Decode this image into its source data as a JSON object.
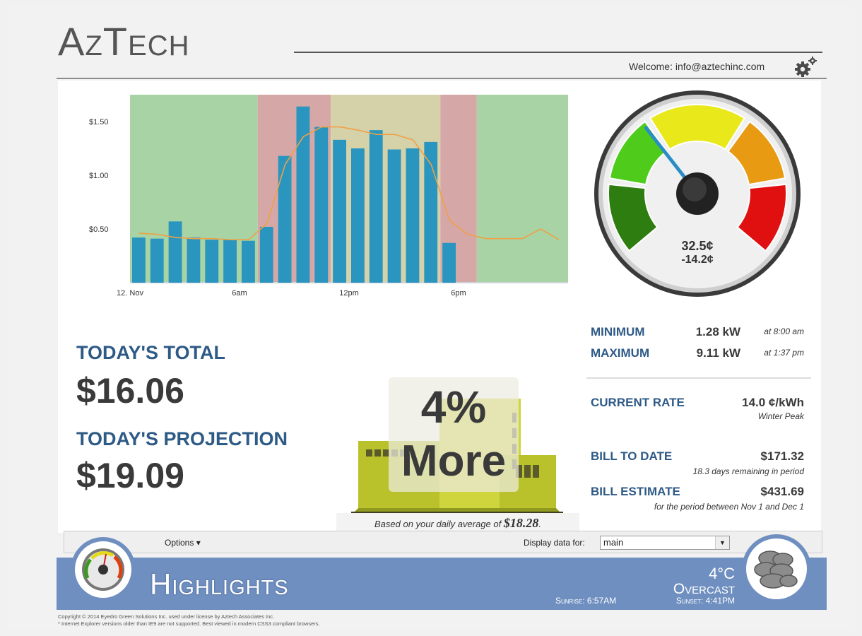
{
  "header": {
    "logo_first": "A",
    "logo_second": "Z",
    "logo_third": "T",
    "logo_rest": "ECH",
    "welcome": "Welcome: info@aztechinc.com",
    "settings_icon": "gears-icon"
  },
  "chart_data": {
    "type": "bar",
    "x_tick_labels": [
      "12. Nov",
      "6am",
      "12pm",
      "6pm"
    ],
    "y_tick_labels": [
      "$1.50",
      "$1.00",
      "$0.50"
    ],
    "ylim": [
      0,
      1.75
    ],
    "hours": [
      0,
      1,
      2,
      3,
      4,
      5,
      6,
      7,
      8,
      9,
      10,
      11,
      12,
      13,
      14,
      15,
      16,
      17
    ],
    "values": [
      0.42,
      0.41,
      0.57,
      0.42,
      0.4,
      0.4,
      0.39,
      0.52,
      1.18,
      1.64,
      1.45,
      1.33,
      1.25,
      1.42,
      1.24,
      1.25,
      1.31,
      0.37
    ],
    "trend": [
      0.46,
      0.45,
      0.42,
      0.41,
      0.41,
      0.4,
      0.4,
      0.55,
      1.1,
      1.36,
      1.45,
      1.45,
      1.42,
      1.38,
      1.38,
      1.33,
      1.1,
      0.58,
      0.45,
      0.41,
      0.41,
      0.41,
      0.5,
      0.4
    ],
    "period_bands": [
      {
        "start": 0,
        "end": 7,
        "color": "#a8d3a4"
      },
      {
        "start": 7,
        "end": 11,
        "color": "#d6a7a7"
      },
      {
        "start": 11,
        "end": 17,
        "color": "#d5d2a9"
      },
      {
        "start": 17,
        "end": 19,
        "color": "#d6a7a7"
      },
      {
        "start": 19,
        "end": 24,
        "color": "#a8d3a4"
      }
    ],
    "bar_color": "#2a95be",
    "trend_color": "#f0a045",
    "grid": false
  },
  "gauge": {
    "value": "32.5¢",
    "sub_value": "-14.2¢",
    "segment_colors": [
      "#2e7d10",
      "#4fcc1b",
      "#e8e81a",
      "#e89a12",
      "#e01010"
    ]
  },
  "totals": {
    "total_label": "TODAY'S TOTAL",
    "total_value": "$16.06",
    "projection_label": "TODAY'S PROJECTION",
    "projection_value": "$19.09"
  },
  "comparison": {
    "percent": "4%",
    "direction": "More",
    "avg_text": "Based on your daily average of",
    "avg_value": "$18.28",
    "avg_suffix": "."
  },
  "stats": {
    "min_label": "MINIMUM",
    "min_value": "1.28 kW",
    "min_time": "at 8:00 am",
    "max_label": "MAXIMUM",
    "max_value": "9.11 kW",
    "max_time": "at 1:37 pm",
    "rate_label": "CURRENT RATE",
    "rate_value": "14.0 ¢/kWh",
    "rate_note": "Winter Peak",
    "bill_label": "BILL TO DATE",
    "bill_value": "$171.32",
    "bill_note": "18.3 days remaining in period",
    "est_label": "BILL ESTIMATE",
    "est_value": "$431.69",
    "est_note": "for the period between Nov 1 and Dec 1"
  },
  "toolbar": {
    "options_label": "Options ▾",
    "display_label": "Display data for:",
    "display_value": "main",
    "display_arrow": "▼"
  },
  "highlights": {
    "title": "Highlights",
    "sunrise": "Sunrise: 6:57AM",
    "temperature": "4°C",
    "condition": "Overcast",
    "sunset": "Sunset: 4:41PM",
    "weather_icon": "cloud-icon",
    "meter_icon": "meter-icon"
  },
  "footer": {
    "line1": "Copyright © 2014 Eyedro Green Solutions Inc. used under license by Aztech Associates Inc.",
    "line2": "* Internet Explorer versions older than IE9 are not supported. Best viewed in modern CSS3 compliant browsers."
  }
}
